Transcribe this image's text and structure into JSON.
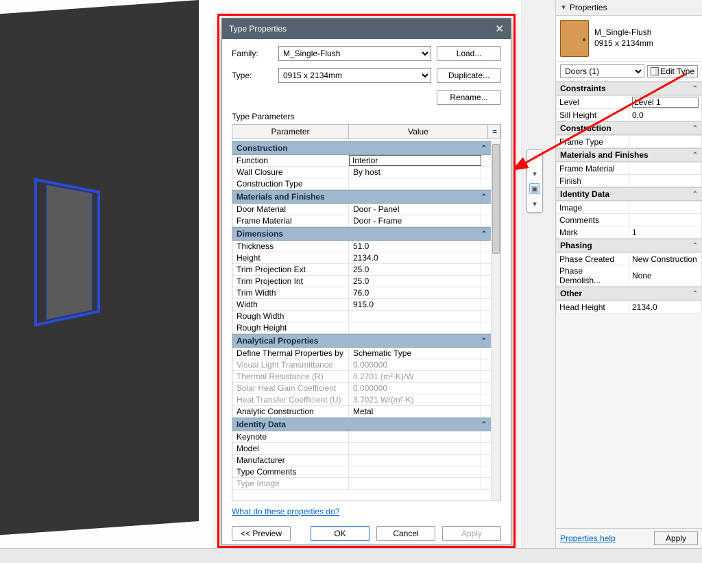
{
  "palette": {
    "title": "Properties",
    "type_name": "M_Single-Flush",
    "type_size": "0915 x 2134mm",
    "selector": "Doors (1)",
    "edit_type": "Edit Type",
    "groups": [
      {
        "name": "Constraints",
        "rows": [
          {
            "k": "Level",
            "v": "Level 1",
            "boxed": true
          },
          {
            "k": "Sill Height",
            "v": "0.0"
          }
        ]
      },
      {
        "name": "Construction",
        "rows": [
          {
            "k": "Frame Type",
            "v": ""
          }
        ]
      },
      {
        "name": "Materials and Finishes",
        "rows": [
          {
            "k": "Frame Material",
            "v": ""
          },
          {
            "k": "Finish",
            "v": ""
          }
        ]
      },
      {
        "name": "Identity Data",
        "rows": [
          {
            "k": "Image",
            "v": ""
          },
          {
            "k": "Comments",
            "v": ""
          },
          {
            "k": "Mark",
            "v": "1"
          }
        ]
      },
      {
        "name": "Phasing",
        "rows": [
          {
            "k": "Phase Created",
            "v": "New Construction"
          },
          {
            "k": "Phase Demolish...",
            "v": "None"
          }
        ]
      },
      {
        "name": "Other",
        "rows": [
          {
            "k": "Head Height",
            "v": "2134.0"
          }
        ]
      }
    ],
    "help": "Properties help",
    "apply": "Apply"
  },
  "dialog": {
    "title": "Type Properties",
    "family_label": "Family:",
    "family_value": "M_Single-Flush",
    "type_label": "Type:",
    "type_value": "0915 x 2134mm",
    "load": "Load...",
    "duplicate": "Duplicate...",
    "rename": "Rename...",
    "section_label": "Type Parameters",
    "head_param": "Parameter",
    "head_value": "Value",
    "head_eq": "=",
    "groups": [
      {
        "name": "Construction",
        "rows": [
          {
            "k": "Function",
            "v": "Interior",
            "boxed": true
          },
          {
            "k": "Wall Closure",
            "v": "By host"
          },
          {
            "k": "Construction Type",
            "v": ""
          }
        ]
      },
      {
        "name": "Materials and Finishes",
        "rows": [
          {
            "k": "Door Material",
            "v": "Door - Panel"
          },
          {
            "k": "Frame Material",
            "v": "Door - Frame"
          }
        ]
      },
      {
        "name": "Dimensions",
        "rows": [
          {
            "k": "Thickness",
            "v": "51.0"
          },
          {
            "k": "Height",
            "v": "2134.0"
          },
          {
            "k": "Trim Projection Ext",
            "v": "25.0"
          },
          {
            "k": "Trim Projection Int",
            "v": "25.0"
          },
          {
            "k": "Trim Width",
            "v": "76.0"
          },
          {
            "k": "Width",
            "v": "915.0"
          },
          {
            "k": "Rough Width",
            "v": ""
          },
          {
            "k": "Rough Height",
            "v": ""
          }
        ]
      },
      {
        "name": "Analytical Properties",
        "rows": [
          {
            "k": "Define Thermal Properties by",
            "v": "Schematic Type"
          },
          {
            "k": "Visual Light Transmittance",
            "v": "0.000000",
            "dim": true
          },
          {
            "k": "Thermal Resistance (R)",
            "v": "0.2701 (m²·K)/W",
            "dim": true
          },
          {
            "k": "Solar Heat Gain Coefficient",
            "v": "0.000000",
            "dim": true
          },
          {
            "k": "Heat Transfer Coefficient (U)",
            "v": "3.7021 W/(m²·K)",
            "dim": true
          },
          {
            "k": "Analytic Construction",
            "v": "Metal"
          }
        ]
      },
      {
        "name": "Identity Data",
        "rows": [
          {
            "k": "Keynote",
            "v": ""
          },
          {
            "k": "Model",
            "v": ""
          },
          {
            "k": "Manufacturer",
            "v": ""
          },
          {
            "k": "Type Comments",
            "v": ""
          },
          {
            "k": "Type Image",
            "v": "",
            "dim": true
          }
        ]
      }
    ],
    "help": "What do these properties do?",
    "preview": "<< Preview",
    "ok": "OK",
    "cancel": "Cancel",
    "apply": "Apply"
  }
}
